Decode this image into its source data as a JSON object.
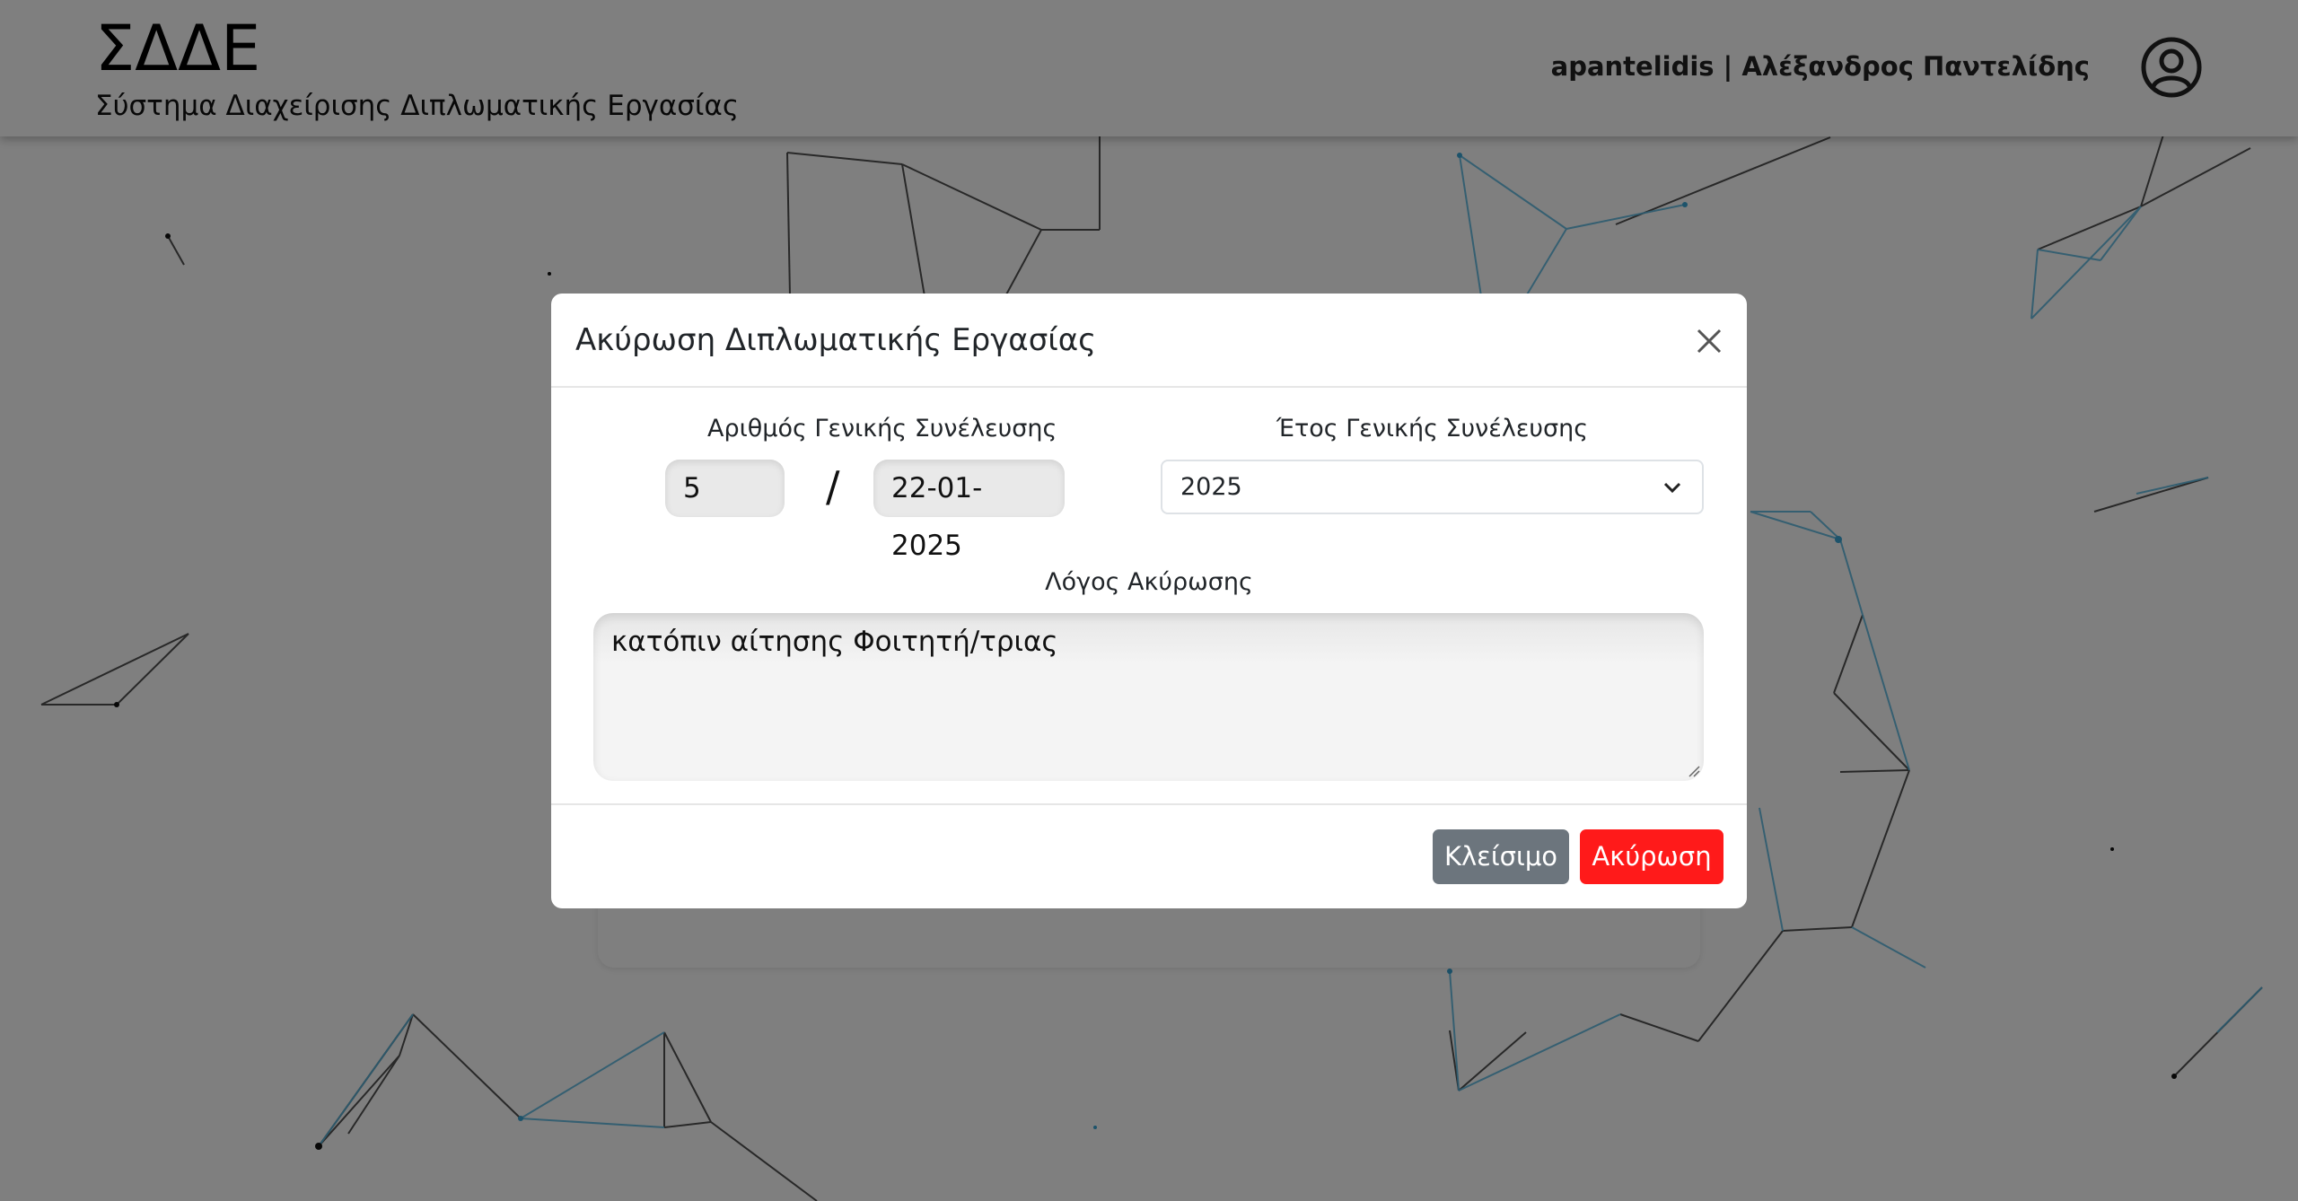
{
  "header": {
    "brand": "ΣΔΔΕ",
    "subtitle": "Σύστημα Διαχείρισης Διπλωματικής Εργασίας",
    "user_info": "apantelidis | Αλέξανδρος Παντελίδης",
    "avatar_icon": "user-circle-icon"
  },
  "modal": {
    "title": "Ακύρωση Διπλωματικής Εργασίας",
    "close_icon": "close-icon",
    "assembly_number_label": "Αριθμός Γενικής Συνέλευσης",
    "assembly_number_value": "5",
    "separator": "/",
    "assembly_date_value": "22-01-2025",
    "assembly_year_label": "Έτος Γενικής Συνέλευσης",
    "assembly_year_selected": "2025",
    "reason_label": "Λόγος Ακύρωσης",
    "reason_value": "κατόπιν αίτησης Φοιτητή/τριας",
    "close_button": "Κλείσιμο",
    "cancel_button": "Ακύρωση"
  },
  "colors": {
    "cancel_button": "#ff1a1a",
    "close_button": "#6c757d",
    "network_blue": "#5bb8e0",
    "network_dark": "#333333"
  }
}
